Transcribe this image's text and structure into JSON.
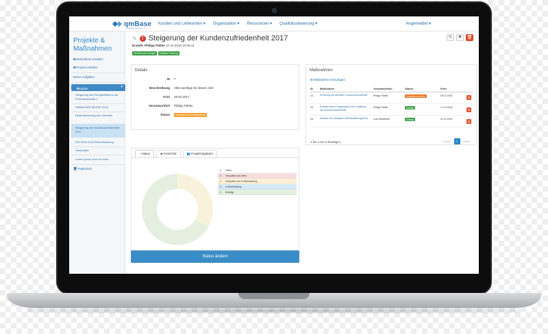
{
  "app": {
    "logo_text": "qmBase",
    "logo_sub": "Qualitätsmanagement"
  },
  "nav": {
    "items": [
      "Kunden und Lieferanten ▾",
      "Organisation ▾",
      "Ressourcen ▾",
      "Qualitätssteuerung ▾"
    ],
    "user": "Angemeldet ▾"
  },
  "sidebar": {
    "title": "Projekte & Maßnahmen",
    "items": [
      "Maßnahme erstellen",
      "Projekt erstellen",
      "Meine Aufgaben"
    ],
    "active_label": "Projekte",
    "projects": [
      "Steigerung der Energieeffizienz der Produktionshalle 1",
      "HANNOVER MESSE 2018",
      "Restrukturierung des Vertriebs",
      "Steigerung der Kundenzufriedenheit 2017",
      "ISO 9001:2015 Rezertifizierung",
      "Testprojekt",
      "Lorem ipsum dolor sit amet"
    ],
    "trash": "Papierkorb"
  },
  "page": {
    "title": "Steigerung der Kundenzufriedenheit 2017",
    "created_label": "Erstellt:",
    "created_by": "Philipp Pähler",
    "created_at": "27.10.2016 10:00:41",
    "tags": [
      "Umwelt und Energie",
      "Software Training"
    ]
  },
  "details": {
    "header": "Details",
    "rows": [
      {
        "key": "ID",
        "value": "7"
      },
      {
        "key": "Beschreibung",
        "value": "Alles wichtige für dieses Jahr"
      },
      {
        "key": "Frist",
        "value": "28.02.2017"
      },
      {
        "key": "Verantwortlich",
        "value": "Philipp Pähler"
      },
      {
        "key": "Status",
        "value": "Verspätet und in Bearbeitung"
      }
    ]
  },
  "massnahmen": {
    "header": "Maßnahmen",
    "add_label": "Maßnahme hinzufügen",
    "columns": [
      "ID",
      "Maßnahme",
      "Verantwortlich",
      "Status",
      "Frist"
    ],
    "rows": [
      {
        "id": "24",
        "title": "Erhebung der aktuellen Kundenzufriedenheit",
        "owner": "Philipp Pähler",
        "status": "Verspätet und offen",
        "status_color": "#e8731f",
        "due": "05.11.2016"
      },
      {
        "id": "25",
        "title": "Erstellen eines Fragebogens zur Ermittlung der Kundenzufriedenheit",
        "owner": "Philipp Pähler",
        "status": "Erledigt",
        "status_color": "#3a9d46",
        "due": "17.10.2016"
      },
      {
        "id": "26",
        "title": "Analyse der wichtigsten Reklamationsgründe",
        "owner": "Lutz Dieckhöfer",
        "status": "Erledigt",
        "status_color": "#3a9d46",
        "due": "31.12.2016"
      }
    ],
    "info": "1 bis 3 von 3 Einträgen",
    "prev": "Zurück",
    "page": "1",
    "next": "Weiter"
  },
  "status_panel": {
    "tabs": [
      "Status",
      "Fortschritt",
      "Projektmitglieder"
    ],
    "legend": [
      {
        "num": "0",
        "label": "Offen",
        "color": "#ffffff"
      },
      {
        "num": "0",
        "label": "Verspätet und offen",
        "color": "#f6dede"
      },
      {
        "num": "1",
        "label": "Verspätet und in Bearbeitung",
        "color": "#fbf1d8"
      },
      {
        "num": "0",
        "label": "In Bearbeitung",
        "color": "#d5eaf6"
      },
      {
        "num": "2",
        "label": "Erledigt",
        "color": "#e3efdf"
      }
    ],
    "donut_values": [
      0,
      0,
      1,
      0,
      2
    ],
    "donut_colors": [
      "#ffffff",
      "#f6dede",
      "#f8f2dc",
      "#d5eaf6",
      "#e4efdf"
    ],
    "button": "Status ändern"
  }
}
